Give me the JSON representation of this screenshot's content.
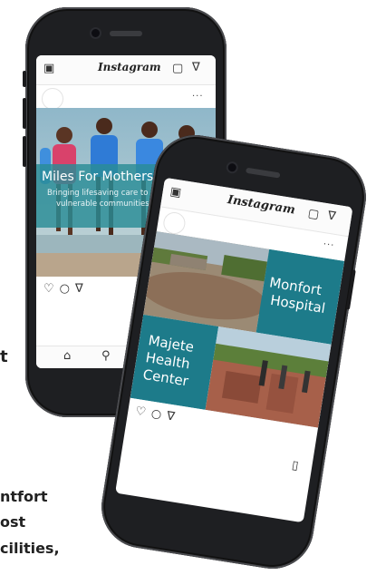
{
  "background_text": {
    "line1": "ntfort",
    "line2": "ost",
    "line3": "cilities,",
    "side": "t"
  },
  "phone1": {
    "app_name": "Instagram",
    "post": {
      "title": "Miles For Mothers",
      "subtitle_line1": "Bringing lifesaving care to",
      "subtitle_line2": "vulnerable communities"
    },
    "actions": [
      "heart",
      "comment",
      "share"
    ],
    "nav": [
      "home",
      "search",
      "add"
    ]
  },
  "phone2": {
    "app_name": "Instagram",
    "post": {
      "top_label_line1": "Monfort",
      "top_label_line2": "Hospital",
      "bottom_label_line1": "Majete",
      "bottom_label_line2": "Health",
      "bottom_label_line3": "Center"
    },
    "actions": [
      "heart",
      "comment",
      "share"
    ]
  },
  "colors": {
    "teal": "#1d7b8a",
    "teal_overlay": "#2a8c96",
    "phone_body": "#1e1f22"
  }
}
